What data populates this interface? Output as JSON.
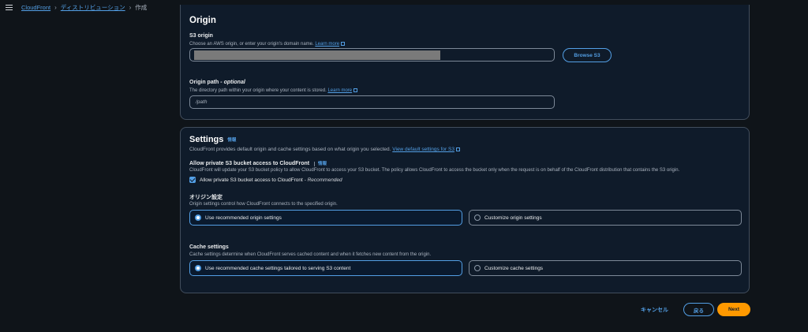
{
  "breadcrumb": {
    "items": [
      "CloudFront",
      "ディストリビューション"
    ],
    "current": "作成"
  },
  "origin": {
    "title": "Origin",
    "s3_label": "S3 origin",
    "s3_desc": "Choose an AWS origin, or enter your origin's domain name.",
    "learn_more": "Learn more",
    "browse_label": "Browse S3",
    "path_label": "Origin path",
    "path_optional": " - optional",
    "path_desc": "The directory path within your origin where your content is stored.",
    "path_placeholder": "/path"
  },
  "settings": {
    "title": "Settings",
    "info": "情報",
    "desc": "CloudFront provides default origin and cache settings based on what origin you selected.",
    "view_default_link": "View default settings for S3",
    "private_label": "Allow private S3 bucket access to CloudFront",
    "private_info": "情報",
    "private_desc": "CloudFront will update your S3 bucket policy to allow CloudFront to access your S3 bucket. The policy allows CloudFront to access the bucket only when the request is on behalf of the CloudFront distribution that contains the S3 origin.",
    "private_checkbox": "Allow private S3 bucket access to CloudFront",
    "private_recommended": " - Recommended",
    "origin_settings_label": "オリジン設定",
    "origin_settings_desc": "Origin settings control how CloudFront connects to the specified origin.",
    "origin_option_recommended": "Use recommended origin settings",
    "origin_option_custom": "Customize origin settings",
    "cache_label": "Cache settings",
    "cache_desc": "Cache settings determine when CloudFront serves cached content and when it fetches new content from the origin.",
    "cache_option_recommended": "Use recommended cache settings tailored to serving S3 content",
    "cache_option_custom": "Customize cache settings"
  },
  "footer": {
    "cancel": "キャンセル",
    "back": "戻る",
    "next": "Next"
  }
}
